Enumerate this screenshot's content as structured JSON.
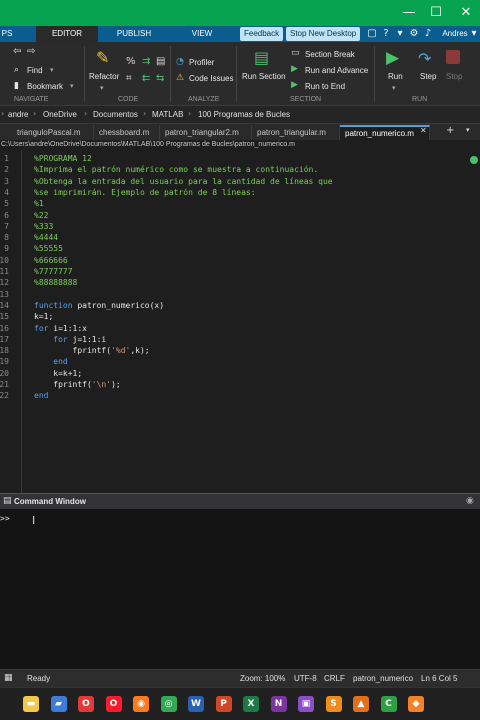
{
  "window": {
    "minimize_glyph": "—",
    "maximize_glyph": "☐",
    "close_glyph": "✕"
  },
  "toolstrip": {
    "tabs": [
      "PS",
      "EDITOR",
      "PUBLISH",
      "VIEW"
    ],
    "active_tab": "EDITOR",
    "feedback_label": "Feedback",
    "stop_desktop_label": "Stop New Desktop",
    "user_label": "Andres"
  },
  "ribbon": {
    "navigate": {
      "find_label": "Find",
      "bookmark_label": "Bookmark",
      "group_label": "NAVIGATE"
    },
    "code": {
      "refactor_label": "Refactor",
      "group_label": "CODE"
    },
    "analyze": {
      "profiler_label": "Profiler",
      "code_issues_label": "Code Issues",
      "group_label": "ANALYZE"
    },
    "section": {
      "run_section_label": "Run Section",
      "section_break_label": "Section Break",
      "run_advance_label": "Run and Advance",
      "run_to_end_label": "Run to End",
      "group_label": "SECTION"
    },
    "run": {
      "run_label": "Run",
      "step_label": "Step",
      "stop_label": "Stop",
      "group_label": "RUN"
    }
  },
  "address_bar": {
    "crumbs": [
      "andre",
      "OneDrive",
      "Documentos",
      "MATLAB",
      "100 Programas de Bucles"
    ]
  },
  "editor_tabs": [
    {
      "label": "trianguloPascal.m"
    },
    {
      "label": "chessboard.m"
    },
    {
      "label": "patron_triangular2.m"
    },
    {
      "label": "patron_triangular.m"
    },
    {
      "label": "patron_numerico.m"
    }
  ],
  "editor_path": "C:\\Users\\andre\\OneDrive\\Documentos\\MATLAB\\100 Programas de Bucles\\patron_numerico.m",
  "code_lines": [
    {
      "n": "1",
      "text": "%PROGRAMA 12",
      "kind": "com"
    },
    {
      "n": "2",
      "text": "%Imprima el patrón numérico como se muestra a continuación.",
      "kind": "com"
    },
    {
      "n": "3",
      "text": "%Obtenga la entrada del usuario para la cantidad de líneas que",
      "kind": "com"
    },
    {
      "n": "4",
      "text": "%se imprimirán. Ejemplo de patrón de 8 líneas:",
      "kind": "com"
    },
    {
      "n": "5",
      "text": "%1",
      "kind": "com"
    },
    {
      "n": "6",
      "text": "%22",
      "kind": "com"
    },
    {
      "n": "7",
      "text": "%333",
      "kind": "com"
    },
    {
      "n": "8",
      "text": "%4444",
      "kind": "com"
    },
    {
      "n": "9",
      "text": "%55555",
      "kind": "com"
    },
    {
      "n": "10",
      "text": "%666666",
      "kind": "com"
    },
    {
      "n": "11",
      "text": "%7777777",
      "kind": "com"
    },
    {
      "n": "12",
      "text": "%88888888",
      "kind": "com"
    },
    {
      "n": "13",
      "text": "",
      "kind": "txt"
    },
    {
      "n": "14",
      "kw": "function",
      "text": " patron_numerico(x)",
      "kind": "mix"
    },
    {
      "n": "15",
      "text": "k=1;",
      "kind": "txt"
    },
    {
      "n": "16",
      "kw": "for",
      "text": " i=1:1:x",
      "kind": "mix"
    },
    {
      "n": "17",
      "indent": "    ",
      "kw": "for",
      "text": " j=1:1:i",
      "kind": "mix"
    },
    {
      "n": "18",
      "indent": "        ",
      "pre": "fprintf(",
      "str": "'%d'",
      "post": ",k);",
      "kind": "strline"
    },
    {
      "n": "19",
      "indent": "    ",
      "kw": "end",
      "text": "",
      "kind": "mix"
    },
    {
      "n": "20",
      "indent": "    ",
      "text": "k=k+1;",
      "kind": "txt"
    },
    {
      "n": "21",
      "indent": "    ",
      "pre": "fprintf(",
      "str": "'\\n'",
      "post": ");",
      "kind": "strline"
    },
    {
      "n": "22",
      "kw": "end",
      "text": "",
      "kind": "mix"
    }
  ],
  "command_window": {
    "title": "Command Window",
    "prompt": ">>"
  },
  "status_bar": {
    "state": "Ready",
    "zoom": "Zoom: 100%",
    "encoding": "UTF-8",
    "line_ending": "CRLF",
    "function_name": "patron_numerico",
    "position": "Ln 6 Col 5"
  },
  "taskbar": {
    "apps": [
      {
        "name": "explorer",
        "glyph": "▬",
        "color": "#f2c94c"
      },
      {
        "name": "app-blue",
        "glyph": "▰",
        "color": "#3b7dd8"
      },
      {
        "name": "opera-gx",
        "glyph": "O",
        "color": "#e03a3a"
      },
      {
        "name": "opera",
        "glyph": "O",
        "color": "#ff1b2d"
      },
      {
        "name": "firefox",
        "glyph": "◉",
        "color": "#ff7a1a"
      },
      {
        "name": "chrome",
        "glyph": "◎",
        "color": "#34a853"
      },
      {
        "name": "word",
        "glyph": "W",
        "color": "#2b5fb4"
      },
      {
        "name": "powerpoint",
        "glyph": "P",
        "color": "#d24726"
      },
      {
        "name": "excel",
        "glyph": "X",
        "color": "#1d7a45"
      },
      {
        "name": "onenote",
        "glyph": "N",
        "color": "#7b34a0"
      },
      {
        "name": "app-purple",
        "glyph": "▣",
        "color": "#8a4fc7"
      },
      {
        "name": "sublime",
        "glyph": "S",
        "color": "#f08c1e"
      },
      {
        "name": "matlab",
        "glyph": "▲",
        "color": "#e0701c"
      },
      {
        "name": "camtasia",
        "glyph": "C",
        "color": "#2ea043"
      },
      {
        "name": "app-orange",
        "glyph": "◆",
        "color": "#f5822a"
      }
    ]
  },
  "colors": {
    "title_bar": "#08a350",
    "toolstrip": "#0a5d8c",
    "comment": "#7ccd5a",
    "keyword": "#5aa0e6"
  }
}
